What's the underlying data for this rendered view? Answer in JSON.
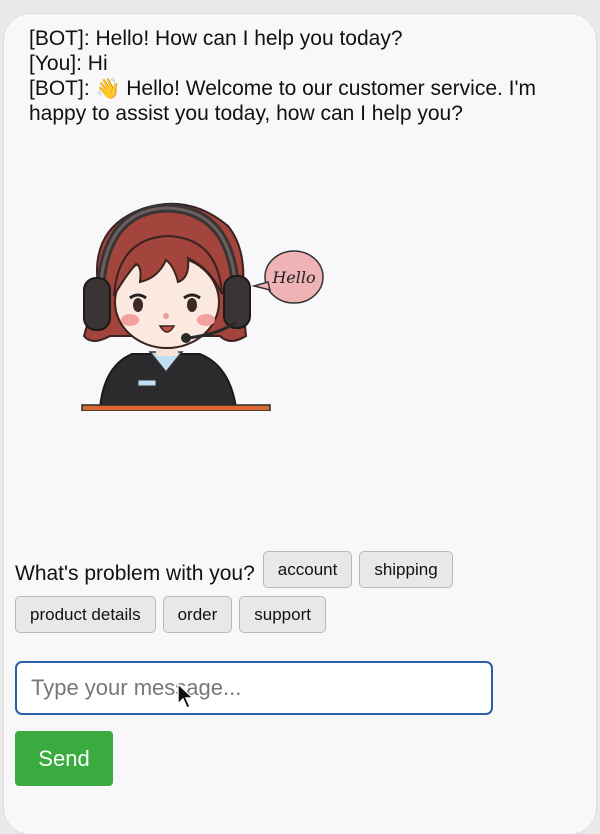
{
  "chat": {
    "messages": [
      {
        "text": "[BOT]: Hello! How can I help you today?"
      },
      {
        "text": "[You]: Hi"
      },
      {
        "prefix": "[BOT]: ",
        "emoji": "👋",
        "text": " Hello! Welcome to our customer service. I'm happy to assist you today, how can I help you?"
      }
    ],
    "speech_bubble": "Hello"
  },
  "quick_replies": {
    "question": "What's problem with you?",
    "options": [
      "account",
      "shipping",
      "product details",
      "order",
      "support"
    ]
  },
  "composer": {
    "placeholder": "Type your message...",
    "send_label": "Send"
  },
  "colors": {
    "send_button": "#3aab3e",
    "input_border": "#2b5ea8",
    "chip_background": "#e8e8ea"
  }
}
